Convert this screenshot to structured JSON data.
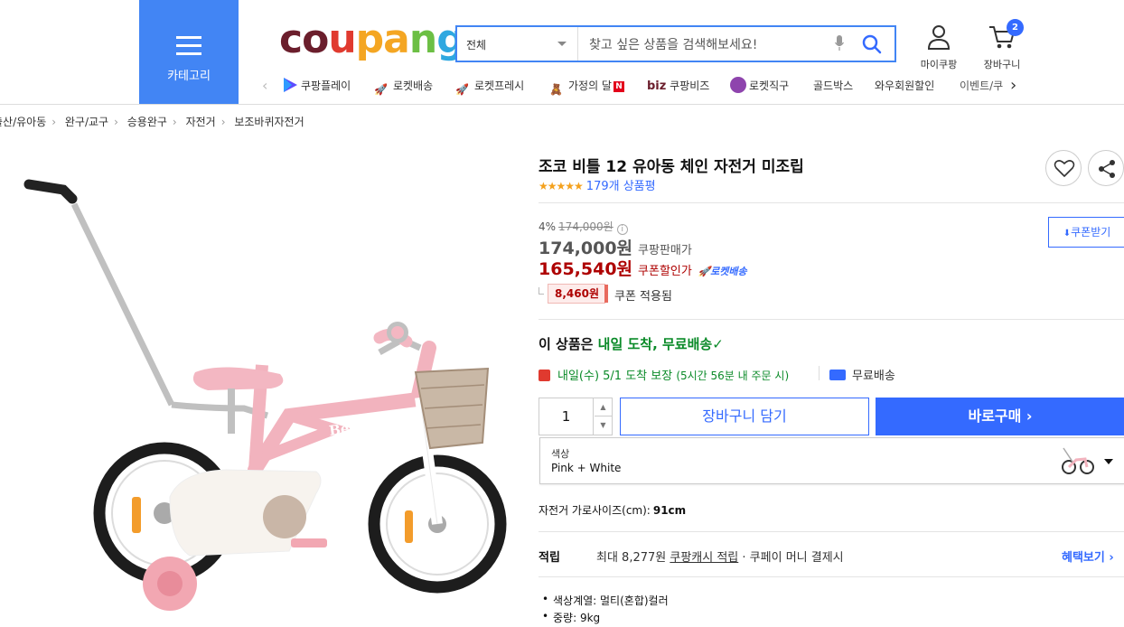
{
  "header": {
    "category_label": "카테고리",
    "logo": [
      "c",
      "o",
      "u",
      "p",
      "a",
      "n",
      "g"
    ],
    "search_category": "전체",
    "search_placeholder": "찾고 싶은 상품을 검색해보세요!",
    "my_coupang": "마이쿠팡",
    "cart_label": "장바구니",
    "cart_count": "2"
  },
  "quicknav": {
    "items": [
      "쿠팡플레이",
      "로켓배송",
      "로켓프레시",
      "가정의 달",
      "쿠팡비즈",
      "로켓직구",
      "골드박스",
      "와우회원할인",
      "이벤트/쿠"
    ],
    "biz_prefix": "biz",
    "new_badge": "N"
  },
  "breadcrumb": [
    "출산/유아동",
    "완구/교구",
    "승용완구",
    "자전거",
    "보조바퀴자전거"
  ],
  "product": {
    "title": "조코 비틀 12 유아동 체인 자전거 미조립",
    "rating_stars": "★★★★★",
    "rating": 4.5,
    "review_count": "179개 상품평",
    "discount_rate": "4%",
    "original_price": "174,000원",
    "sale_price": "174,000원",
    "sale_price_label": "쿠팡판매가",
    "coupon_price": "165,540원",
    "coupon_price_label": "쿠폰할인가",
    "rocket_label": "로켓배송",
    "coupon_amount": "8,460원",
    "coupon_applied": "쿠폰 적용됨",
    "coupon_download": "쿠폰받기"
  },
  "delivery": {
    "prefix": "이 상품은 ",
    "highlight": "내일 도착, 무료배송",
    "check": "✓",
    "date": "내일(수) 5/1 도착 보장",
    "note": "(5시간 56분 내 주문 시)",
    "free_shipping": "무료배송"
  },
  "purchase": {
    "quantity": "1",
    "add_to_cart": "장바구니 담기",
    "buy_now": "바로구매 ›"
  },
  "option": {
    "label": "색상",
    "value": "Pink + White"
  },
  "spec": {
    "label": "자전거 가로사이즈(cm):",
    "value": "91cm"
  },
  "cashback": {
    "label": "적립",
    "text_prefix": "최대 8,277원 ",
    "link": "쿠팡캐시 적립",
    "text_suffix": " · 쿠페이 머니 결제시",
    "benefit": "혜택보기 ›"
  },
  "attributes": [
    "색상계열: 멀티(혼합)컬러",
    "중량: 9kg"
  ],
  "colors": {
    "accent": "#346aff",
    "category_bg": "#4285f4",
    "price_red": "#ae0000",
    "delivery_green": "#0a8a28"
  }
}
